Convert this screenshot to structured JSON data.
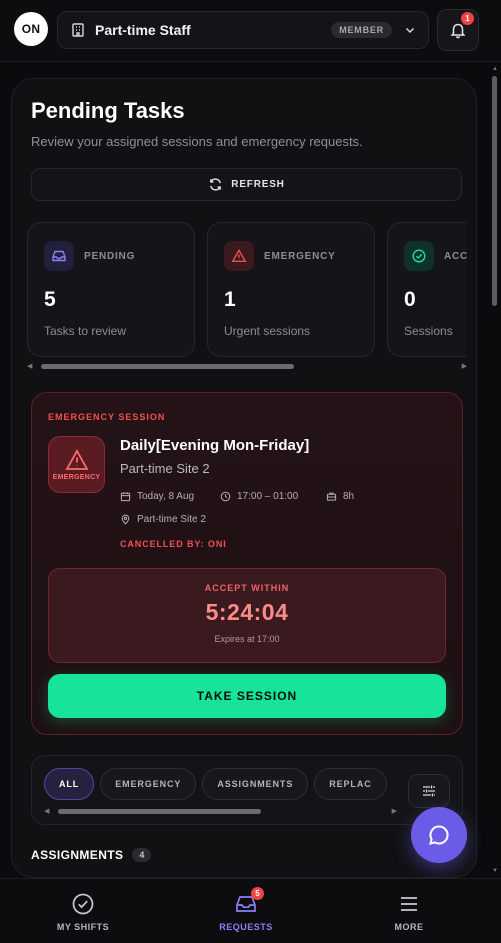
{
  "header": {
    "avatar_initials": "ON",
    "org_name": "Part-time Staff",
    "role_badge": "MEMBER",
    "notification_count": "1"
  },
  "main": {
    "title": "Pending Tasks",
    "subtitle": "Review your assigned sessions and emergency requests.",
    "refresh_label": "REFRESH",
    "stats": [
      {
        "label": "PENDING",
        "value": "5",
        "caption": "Tasks to review",
        "icon": "inbox-icon",
        "color": "#8b80f5"
      },
      {
        "label": "EMERGENCY",
        "value": "1",
        "caption": "Urgent sessions",
        "icon": "warning-icon",
        "color": "#f05252"
      },
      {
        "label": "ACC",
        "value": "0",
        "caption": "Sessions",
        "icon": "check-circle-icon",
        "color": "#17e39b"
      }
    ]
  },
  "emergency": {
    "tag": "EMERGENCY SESSION",
    "icon_text": "EMERGENCY",
    "title": "Daily[Evening Mon-Friday]",
    "site": "Part-time Site 2",
    "date": "Today, 8 Aug",
    "time": "17:00 – 01:00",
    "duration": "8h",
    "location": "Part-time Site 2",
    "cancelled_by": "CANCELLED BY: ONI",
    "accept_within_label": "ACCEPT WITHIN",
    "countdown": "5:24:04",
    "expires": "Expires at 17:00",
    "take_button": "TAKE SESSION"
  },
  "filters": {
    "chips": [
      "ALL",
      "EMERGENCY",
      "ASSIGNMENTS",
      "REPLAC"
    ],
    "active": "ALL"
  },
  "assignments": {
    "heading": "ASSIGNMENTS",
    "count": "4"
  },
  "bottom_nav": {
    "items": [
      {
        "label": "MY SHIFTS",
        "icon": "check-circle-icon"
      },
      {
        "label": "REQUESTS",
        "icon": "inbox-icon",
        "badge": "5"
      },
      {
        "label": "MORE",
        "icon": "menu-icon"
      }
    ]
  },
  "colors": {
    "accent": "#8b80f5",
    "emergency": "#f05252",
    "success": "#17e39b",
    "fab": "#6b5ce7"
  }
}
